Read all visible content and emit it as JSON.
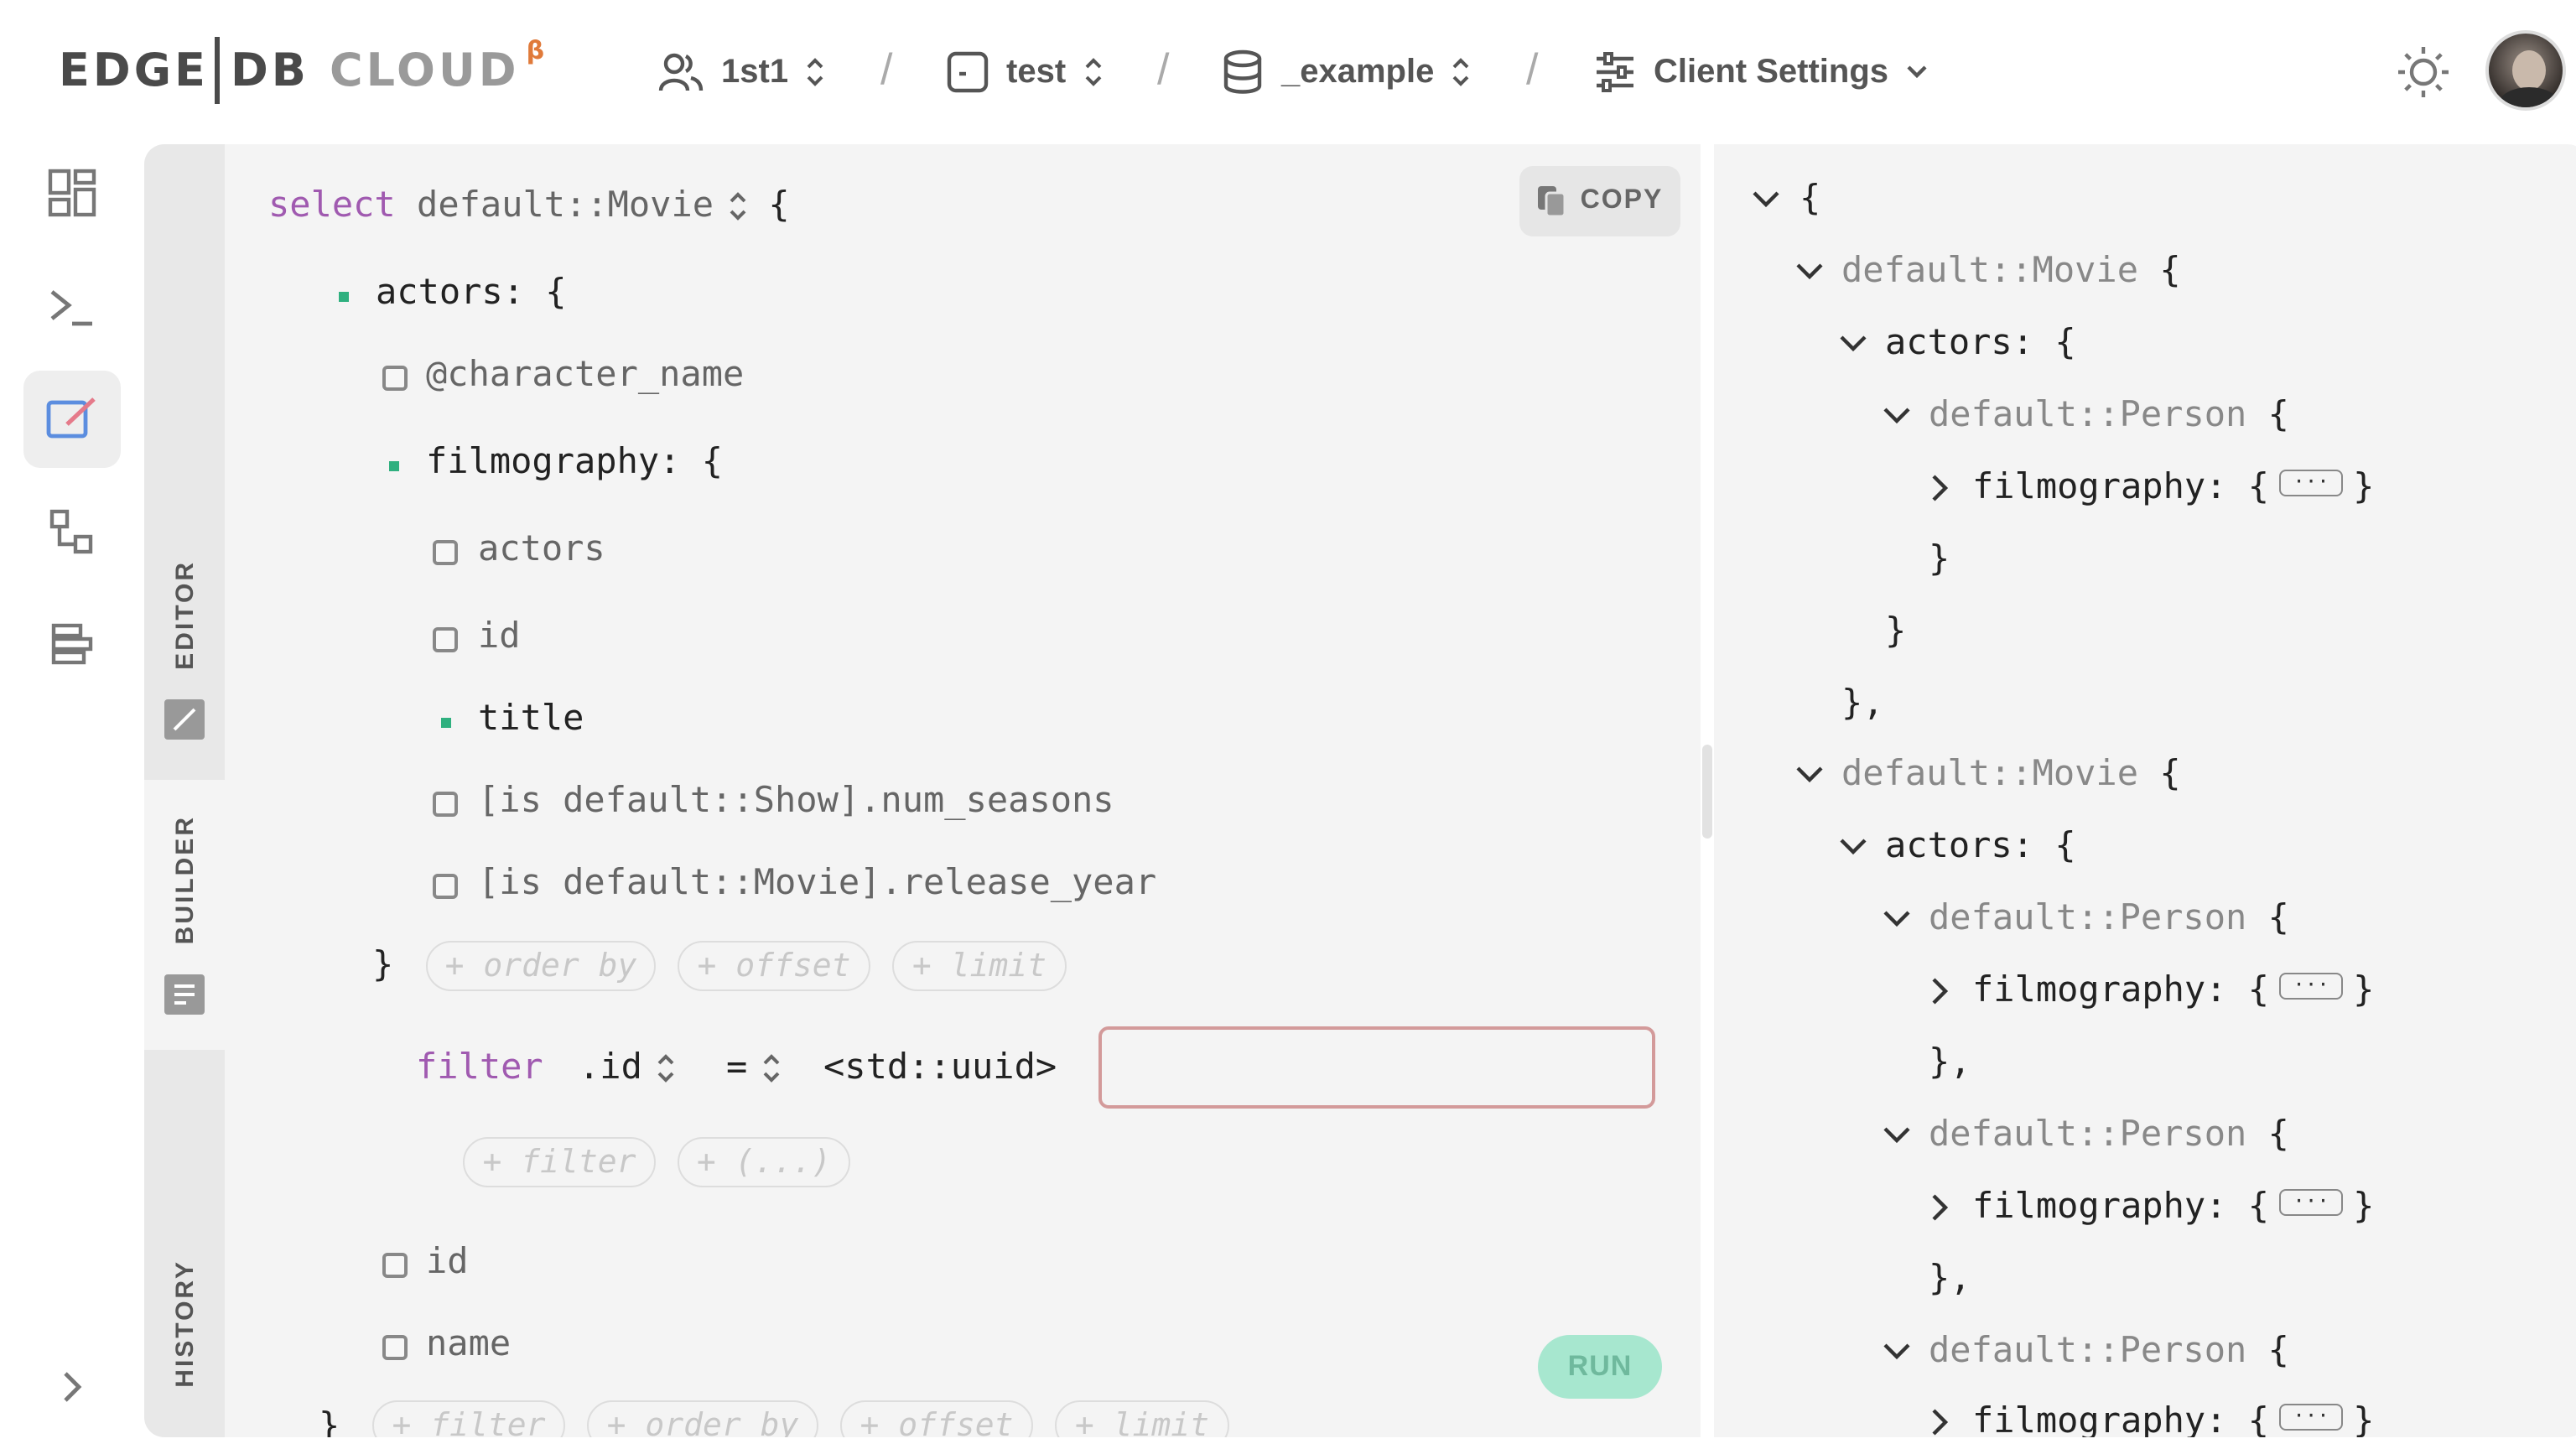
{
  "header": {
    "logo": {
      "edge": "EDGE",
      "db": "DB",
      "cloud": "CLOUD",
      "beta": "β"
    },
    "breadcrumbs": [
      {
        "label": "1st1",
        "icon": "users-icon"
      },
      {
        "label": "test",
        "icon": "instance-icon"
      },
      {
        "label": "_example",
        "icon": "database-icon"
      },
      {
        "label": "Client Settings",
        "icon": "sliders-icon"
      }
    ],
    "separator": "/",
    "theme_icon": "sun-icon"
  },
  "nav": {
    "items": [
      "dashboard-icon",
      "repl-icon",
      "editor-icon",
      "schema-icon",
      "data-icon"
    ],
    "active": "editor-icon",
    "expand_icon": "chevron-right-icon"
  },
  "tabs": {
    "editor": "EDITOR",
    "builder": "BUILDER",
    "history": "HISTORY"
  },
  "builder": {
    "copy_label": "COPY",
    "select_kw": "select",
    "root_type": "default::Movie",
    "open_brace": "{",
    "close_brace": "}",
    "actors_label": "actors: {",
    "character_name": "@character_name",
    "filmography_label": "filmography: {",
    "film_actors": "actors",
    "film_id": "id",
    "film_title": "title",
    "num_seasons": "[is default::Show].num_seasons",
    "release_year": "[is default::Movie].release_year",
    "inner_pills": [
      "+ order by",
      "+ offset",
      "+ limit"
    ],
    "filter_kw": "filter",
    "filter_field": ".id",
    "filter_op": "=",
    "filter_type": "<std::uuid>",
    "filter_value": "",
    "filter_pills": [
      "+ filter",
      "+ (...)"
    ],
    "actor_id": "id",
    "actor_name": "name",
    "outer_pills": [
      "+ filter",
      "+ order by",
      "+ offset",
      "+ limit"
    ],
    "run_label": "RUN"
  },
  "result": {
    "open": "{",
    "movie_type": "default::Movie",
    "person_type": "default::Person",
    "actors": "actors:",
    "filmography": "filmography:",
    "ellipsis": "···",
    "brace_open": "{",
    "brace_close": "}",
    "close_comma": "},"
  }
}
